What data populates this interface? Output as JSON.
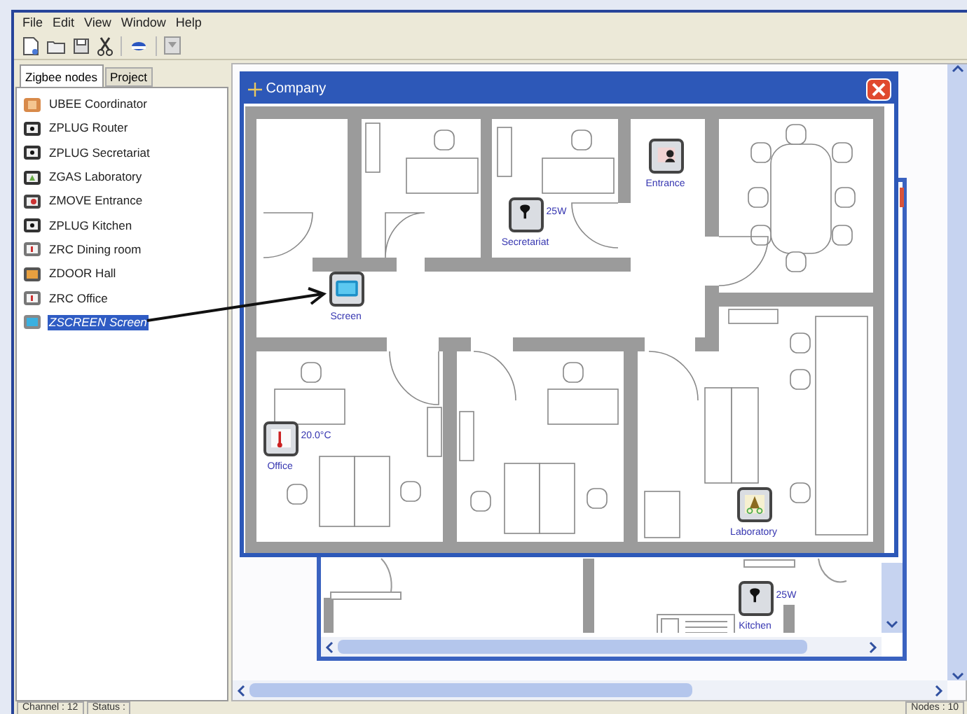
{
  "menu": [
    "File",
    "Edit",
    "View",
    "Window",
    "Help"
  ],
  "tabs": [
    {
      "label": "Zigbee nodes",
      "selected": true
    },
    {
      "label": "Project",
      "selected": false
    }
  ],
  "nodes": [
    {
      "label": "UBEE Coordinator",
      "kind": "coordinator",
      "selected": false
    },
    {
      "label": "ZPLUG Router",
      "kind": "plug",
      "selected": false
    },
    {
      "label": "ZPLUG Secretariat",
      "kind": "plug",
      "selected": false
    },
    {
      "label": "ZGAS Laboratory",
      "kind": "gas",
      "selected": false
    },
    {
      "label": "ZMOVE Entrance",
      "kind": "move",
      "selected": false
    },
    {
      "label": "ZPLUG Kitchen",
      "kind": "plug",
      "selected": false
    },
    {
      "label": "ZRC Dining room",
      "kind": "rc",
      "selected": false
    },
    {
      "label": "ZDOOR Hall",
      "kind": "door",
      "selected": false
    },
    {
      "label": "ZRC Office",
      "kind": "rc",
      "selected": false
    },
    {
      "label": "ZSCREEN Screen",
      "kind": "screen",
      "selected": true
    }
  ],
  "front_window": {
    "title": "Company",
    "devices": [
      {
        "label": "Entrance",
        "kind": "move"
      },
      {
        "label": "Secretariat",
        "kind": "plug",
        "reading": "25W"
      },
      {
        "label": "Screen",
        "kind": "screen"
      },
      {
        "label": "Office",
        "kind": "rc",
        "reading": "20.0°C"
      },
      {
        "label": "Laboratory",
        "kind": "gas"
      }
    ]
  },
  "back_window": {
    "devices": [
      {
        "label": "Kitchen",
        "kind": "plug",
        "reading": "25W"
      }
    ]
  },
  "status_bar": [
    "Channel : 12",
    "Status :",
    "Nodes : 10"
  ]
}
